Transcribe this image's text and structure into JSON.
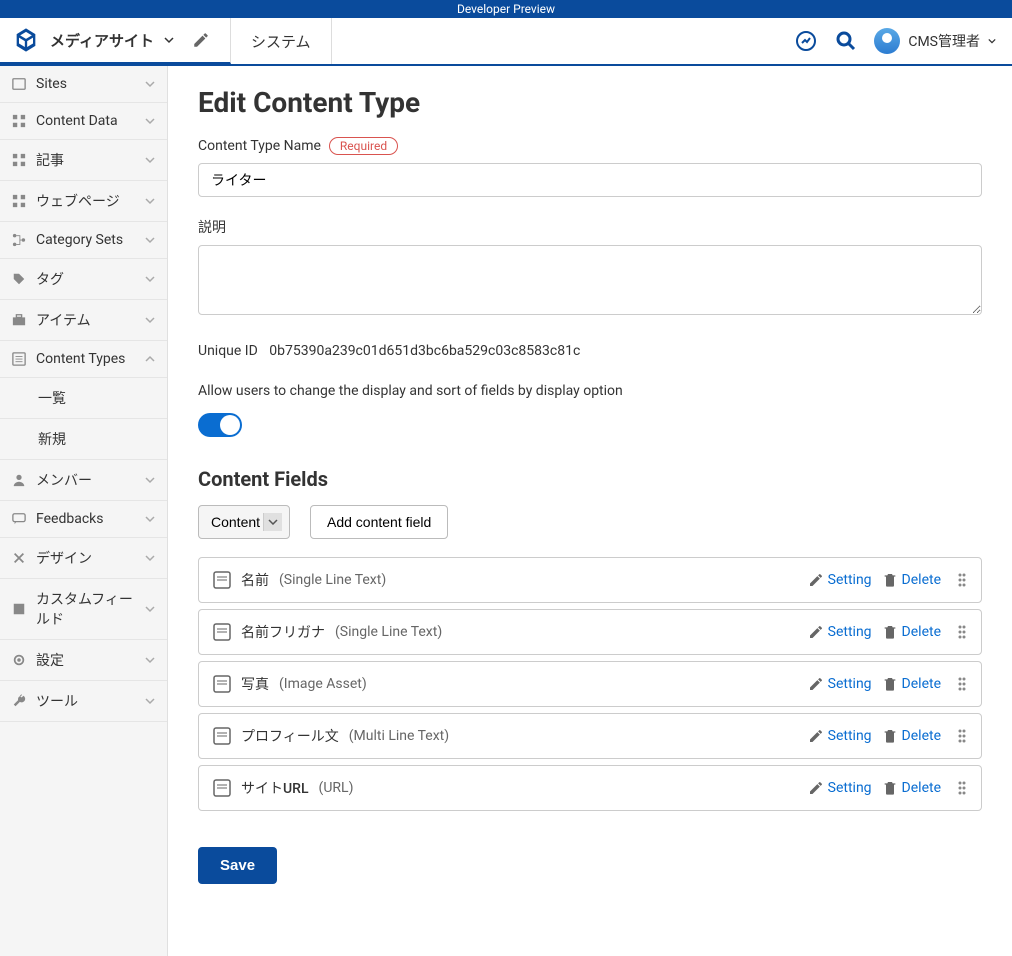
{
  "preview_bar": "Developer Preview",
  "header": {
    "brand": "メディアサイト",
    "system": "システム",
    "user": "CMS管理者"
  },
  "sidebar": {
    "items": [
      {
        "icon": "sites",
        "label": "Sites"
      },
      {
        "icon": "grid",
        "label": "Content Data"
      },
      {
        "icon": "grid",
        "label": "記事"
      },
      {
        "icon": "grid",
        "label": "ウェブページ"
      },
      {
        "icon": "tree",
        "label": "Category Sets"
      },
      {
        "icon": "tag",
        "label": "タグ"
      },
      {
        "icon": "briefcase",
        "label": "アイテム"
      },
      {
        "icon": "list",
        "label": "Content Types",
        "expanded": true
      },
      {
        "icon": "user",
        "label": "メンバー"
      },
      {
        "icon": "chat",
        "label": "Feedbacks"
      },
      {
        "icon": "cross",
        "label": "デザイン"
      },
      {
        "icon": "puzzle",
        "label": "カスタムフィールド"
      },
      {
        "icon": "gear",
        "label": "設定"
      },
      {
        "icon": "wrench",
        "label": "ツール"
      }
    ],
    "sub_items": [
      "一覧",
      "新規"
    ]
  },
  "page": {
    "title": "Edit Content Type",
    "name_label": "Content Type Name",
    "required": "Required",
    "name_value": "ライター",
    "desc_label": "説明",
    "desc_value": "",
    "uid_label": "Unique ID",
    "uid_value": "0b75390a239c01d651d3bc6ba529c03c8583c81c",
    "toggle_label": "Allow users to change the display and sort of fields by display option",
    "fields_heading": "Content Fields",
    "select_value": "Content",
    "add_button": "Add content field",
    "setting_label": "Setting",
    "delete_label": "Delete",
    "save": "Save",
    "fields": [
      {
        "name": "名前",
        "type": "(Single Line Text)"
      },
      {
        "name": "名前フリガナ",
        "type": "(Single Line Text)"
      },
      {
        "name": "写真",
        "type": "(Image Asset)"
      },
      {
        "name": "プロフィール文",
        "type": "(Multi Line Text)"
      },
      {
        "name": "サイトURL",
        "type": "(URL)"
      }
    ]
  }
}
